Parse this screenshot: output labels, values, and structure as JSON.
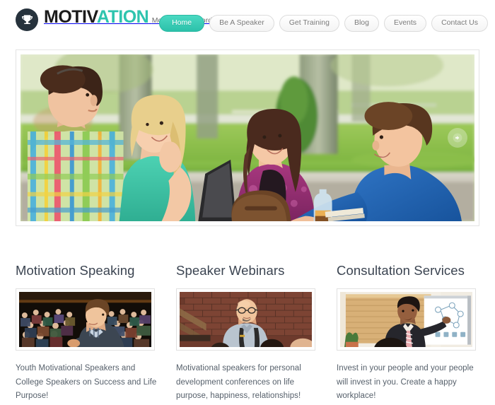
{
  "header": {
    "logo": {
      "icon": "trophy-icon",
      "word_dark": "MOTIV",
      "word_accent": "ATION",
      "tagline": "Motivational Wordpress Theme",
      "mark_color": "#26323c",
      "accent_color": "#2ec4ae"
    },
    "nav": [
      {
        "label": "Home",
        "active": true
      },
      {
        "label": "Be A Speaker",
        "active": false
      },
      {
        "label": "Get Training",
        "active": false
      },
      {
        "label": "Blog",
        "active": false
      },
      {
        "label": "Events",
        "active": false
      },
      {
        "label": "Contact Us",
        "active": false
      }
    ]
  },
  "hero": {
    "alt": "Group of four college students smiling and talking around an outdoor table in a park with a laptop, backpack and drink bottle",
    "next_icon": "arrow-right-icon",
    "prev_icon": "arrow-left-icon"
  },
  "columns": [
    {
      "title": "Motivation Speaking",
      "image_alt": "Male speaker on stage addressing a large seated audience in a dark auditorium",
      "text": "Youth Motivational Speakers and College Speakers on Success and Life Purpose!"
    },
    {
      "title": "Speaker Webinars",
      "image_alt": "Bald man with glasses and suspenders speaking in front of a red brick wall",
      "text": "Motivational speakers for personal development conferences on life purpose, happiness, relationships!"
    },
    {
      "title": "Consultation Services",
      "image_alt": "Man in a dark suit and striped tie presenting a diagram on a white flipchart in a wood-panelled room",
      "text": "Invest in your people and your people will invest in you. Create a happy workplace!"
    }
  ],
  "theme": {
    "accent": "#2ec4ae",
    "heading_color": "#3b4451",
    "body_text_color": "#56606b",
    "nav_text_color": "#7b7b7b"
  }
}
